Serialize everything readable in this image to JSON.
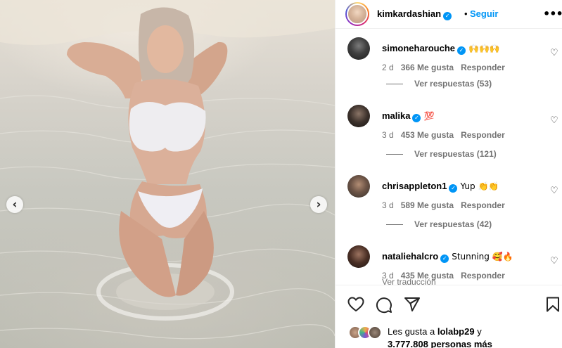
{
  "post": {
    "username": "kimkardashian",
    "verified_mark": "✓",
    "dot": "•",
    "follow_label": "Seguir",
    "more_icon": "•••"
  },
  "photo": {
    "prev_arrow": "‹",
    "next_arrow": "›"
  },
  "comments": [
    {
      "username": "simoneharouche",
      "text": "🙌🙌🙌",
      "time": "2 d",
      "likes": "366 Me gusta",
      "reply": "Responder",
      "view_replies": "Ver respuestas (53)"
    },
    {
      "username": "malika",
      "text": "💯",
      "time": "3 d",
      "likes": "453 Me gusta",
      "reply": "Responder",
      "view_replies": "Ver respuestas (121)"
    },
    {
      "username": "chrisappleton1",
      "text": "Yup 👏👏",
      "time": "3 d",
      "likes": "589 Me gusta",
      "reply": "Responder",
      "view_replies": "Ver respuestas (42)"
    },
    {
      "username": "nataliehalcro",
      "text": "Stunning 🥰🔥",
      "time": "3 d",
      "likes": "435 Me gusta",
      "reply": "Responder",
      "translate": "Ver traducción"
    }
  ],
  "heart_icon": "♡",
  "likes": {
    "prefix": "Les gusta a",
    "user": "lolabp29",
    "conjunction": "y",
    "count": "3.777.808 personas más"
  },
  "icons": {
    "like": "heart-icon",
    "comment": "comment-icon",
    "share": "share-icon",
    "save": "bookmark-icon"
  },
  "colors": {
    "accent": "#0095f6",
    "muted": "#737373"
  }
}
